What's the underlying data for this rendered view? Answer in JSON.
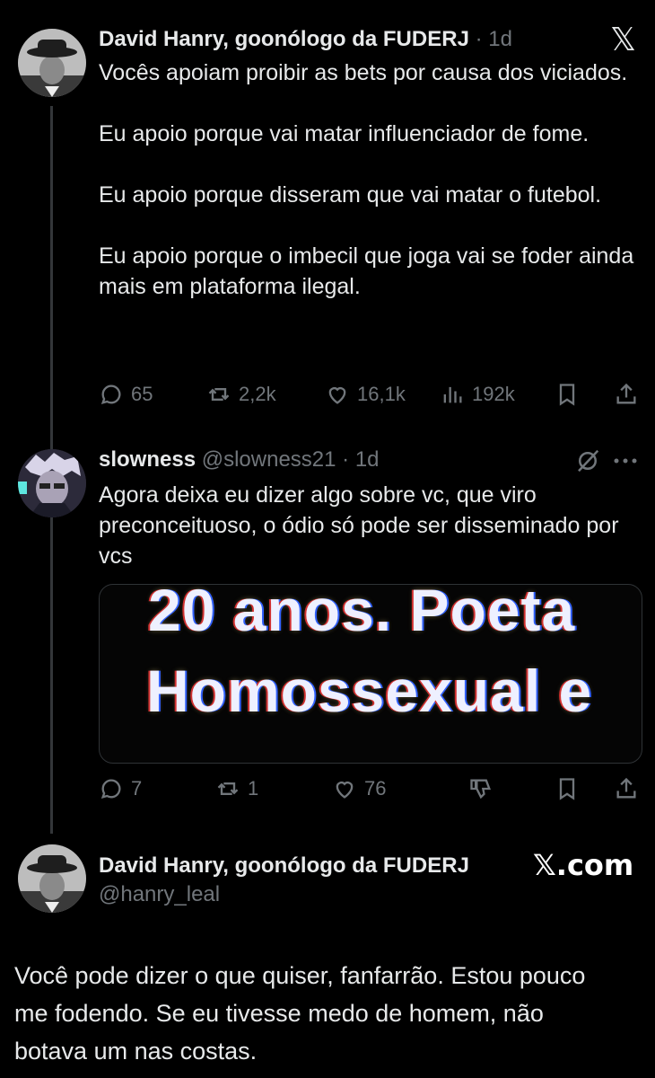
{
  "tweet1": {
    "author_name": "David Hanry, goonólogo da FUDERJ",
    "time": "· 1d",
    "body": "Vocês apoiam proibir as bets por causa dos viciados.\n\nEu apoio porque vai matar influenciador de fome.\n\nEu apoio porque disseram que vai matar o futebol.\n\nEu apoio porque o imbecil que joga vai se foder ainda mais em plataforma ilegal.",
    "actions": {
      "replies": "65",
      "reposts": "2,2k",
      "likes": "16,1k",
      "views": "192k"
    },
    "platform_logo": "𝕏"
  },
  "tweet2": {
    "author_name": "slowness",
    "handle": "@slowness21",
    "time": "· 1d",
    "body": "Agora deixa eu dizer algo sobre vc, que viro preconceituoso, o ódio só pode ser disseminado por vcs",
    "image_text_line1": "20 anos. Poeta",
    "image_text_line2": "Homossexual e",
    "actions": {
      "replies": "7",
      "reposts": "1",
      "likes": "76"
    },
    "icons": [
      "grok-icon",
      "more-icon"
    ]
  },
  "quote_header": {
    "author_name": "David Hanry, goonólogo da FUDERJ",
    "handle": "@hanry_leal",
    "brand": "𝕏.com"
  },
  "reply": {
    "body": "Você pode dizer o que quiser, fanfarrão. Estou pouco me fodendo. Se eu tivesse medo de homem, não botava um nas costas."
  },
  "colors": {
    "background": "#000000",
    "text": "#e7e9ea",
    "muted": "#71767b",
    "divider": "#2f3336"
  }
}
